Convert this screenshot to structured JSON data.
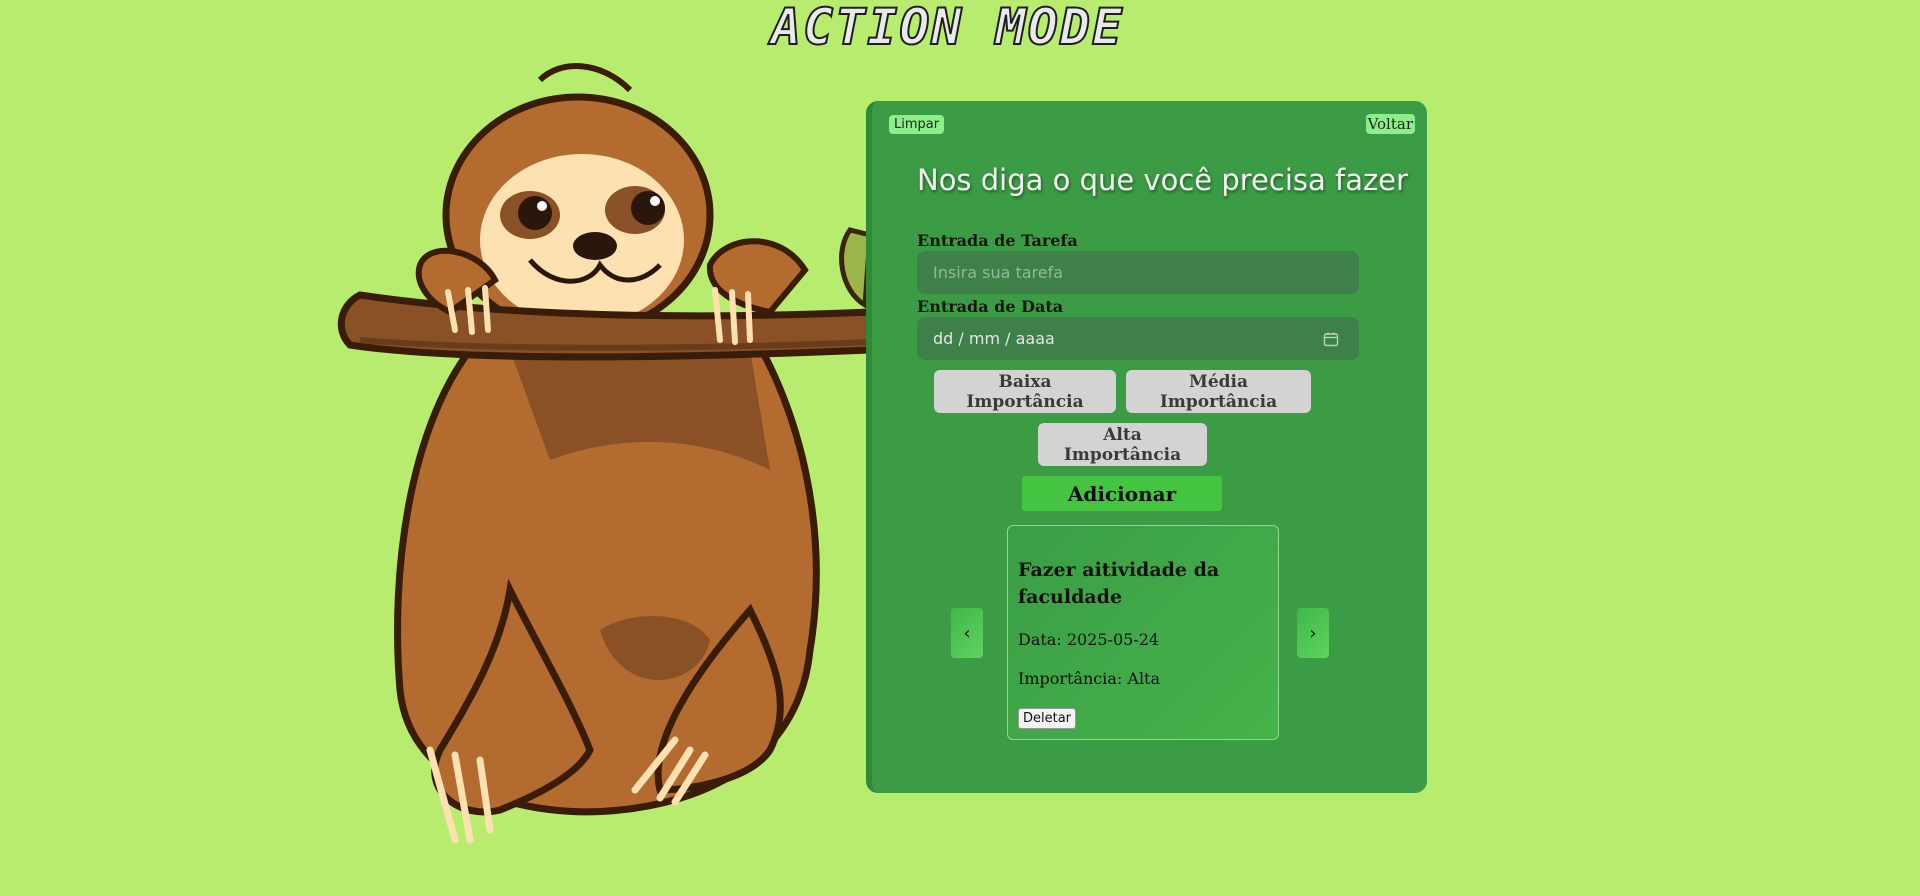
{
  "app": {
    "title": "ACTION MODE"
  },
  "panel": {
    "clear_label": "Limpar",
    "back_label": "Voltar",
    "heading": "Nos diga o que você precisa fazer",
    "task_label": "Entrada de Tarefa",
    "task_placeholder": "Insira sua tarefa",
    "date_label": "Entrada de Data",
    "date_placeholder": "dd / mm / aaaa",
    "importance_options": [
      "Baixa Importância",
      "Média Importância",
      "Alta Importância"
    ],
    "add_label": "Adicionar",
    "prev_label": "‹",
    "next_label": "›"
  },
  "task_card": {
    "title": "Fazer aitividade da faculdade",
    "date_text": "Data: 2025-05-24",
    "importance_text": "Importância: Alta",
    "delete_label": "Deletar"
  },
  "colors": {
    "background": "#b8ec6e",
    "panel": "#3c9c45",
    "accent": "#45c442"
  }
}
